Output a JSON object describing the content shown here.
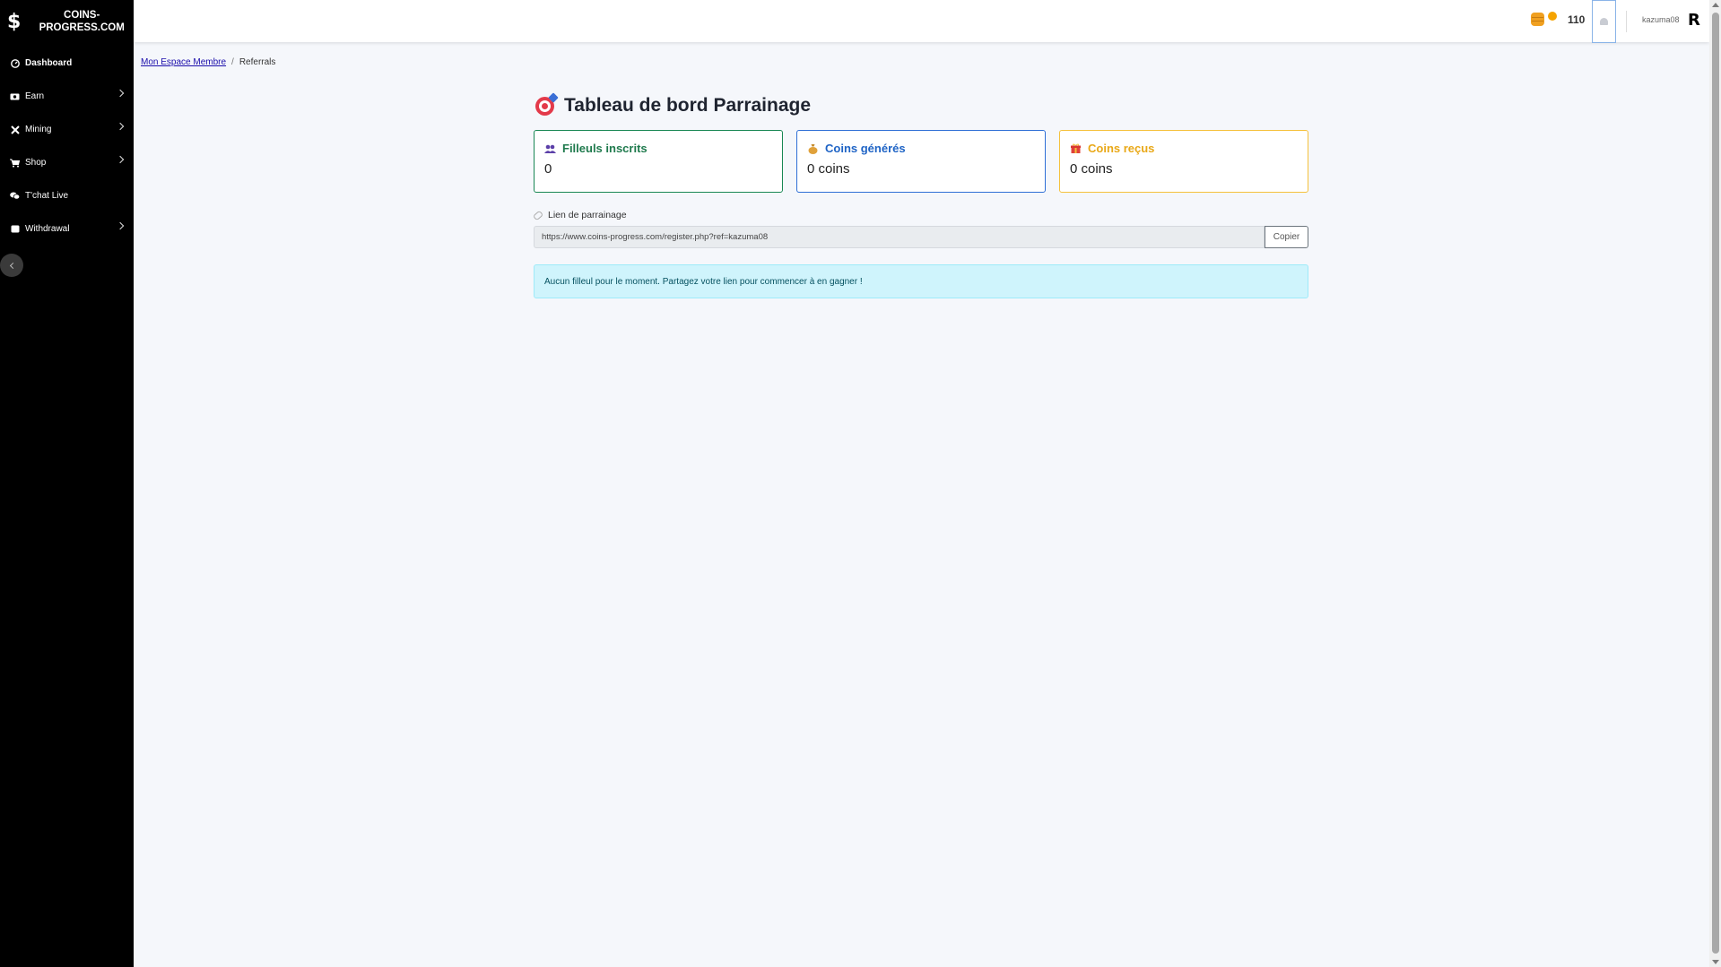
{
  "brand": {
    "icon": "dollar-sign-icon",
    "name": "COINS-PROGRESS.COM"
  },
  "sidebar": {
    "items": [
      {
        "label": "Dashboard",
        "icon": "dashboard-icon",
        "has_submenu": false
      },
      {
        "label": "Earn",
        "icon": "money-icon",
        "has_submenu": true
      },
      {
        "label": "Mining",
        "icon": "tools-icon",
        "has_submenu": true
      },
      {
        "label": "Shop",
        "icon": "cart-icon",
        "has_submenu": true
      },
      {
        "label": "T'chat Live",
        "icon": "chat-icon",
        "has_submenu": false
      },
      {
        "label": "Withdrawal",
        "icon": "wallet-icon",
        "has_submenu": true
      }
    ]
  },
  "topbar": {
    "coin_count": "110",
    "username": "kazuma08",
    "avatar_letter": "R"
  },
  "breadcrumb": {
    "home": "Mon Espace Membre",
    "separator": "/",
    "current": "Referrals"
  },
  "page": {
    "title": "Tableau de bord Parrainage"
  },
  "cards": {
    "filleuls": {
      "label": "Filleuls inscrits",
      "value": "0",
      "color": "#198754"
    },
    "generes": {
      "label": "Coins générés",
      "value": "0 coins",
      "color": "#2f6fd6"
    },
    "recus": {
      "label": "Coins reçus",
      "value": "0 coins",
      "color": "#f5c13c"
    }
  },
  "referral": {
    "label": "Lien de parrainage",
    "url": "https://www.coins-progress.com/register.php?ref=kazuma08",
    "copy_label": "Copier"
  },
  "alert": {
    "text": "Aucun filleul pour le moment. Partagez votre lien pour commencer à en gagner !"
  }
}
